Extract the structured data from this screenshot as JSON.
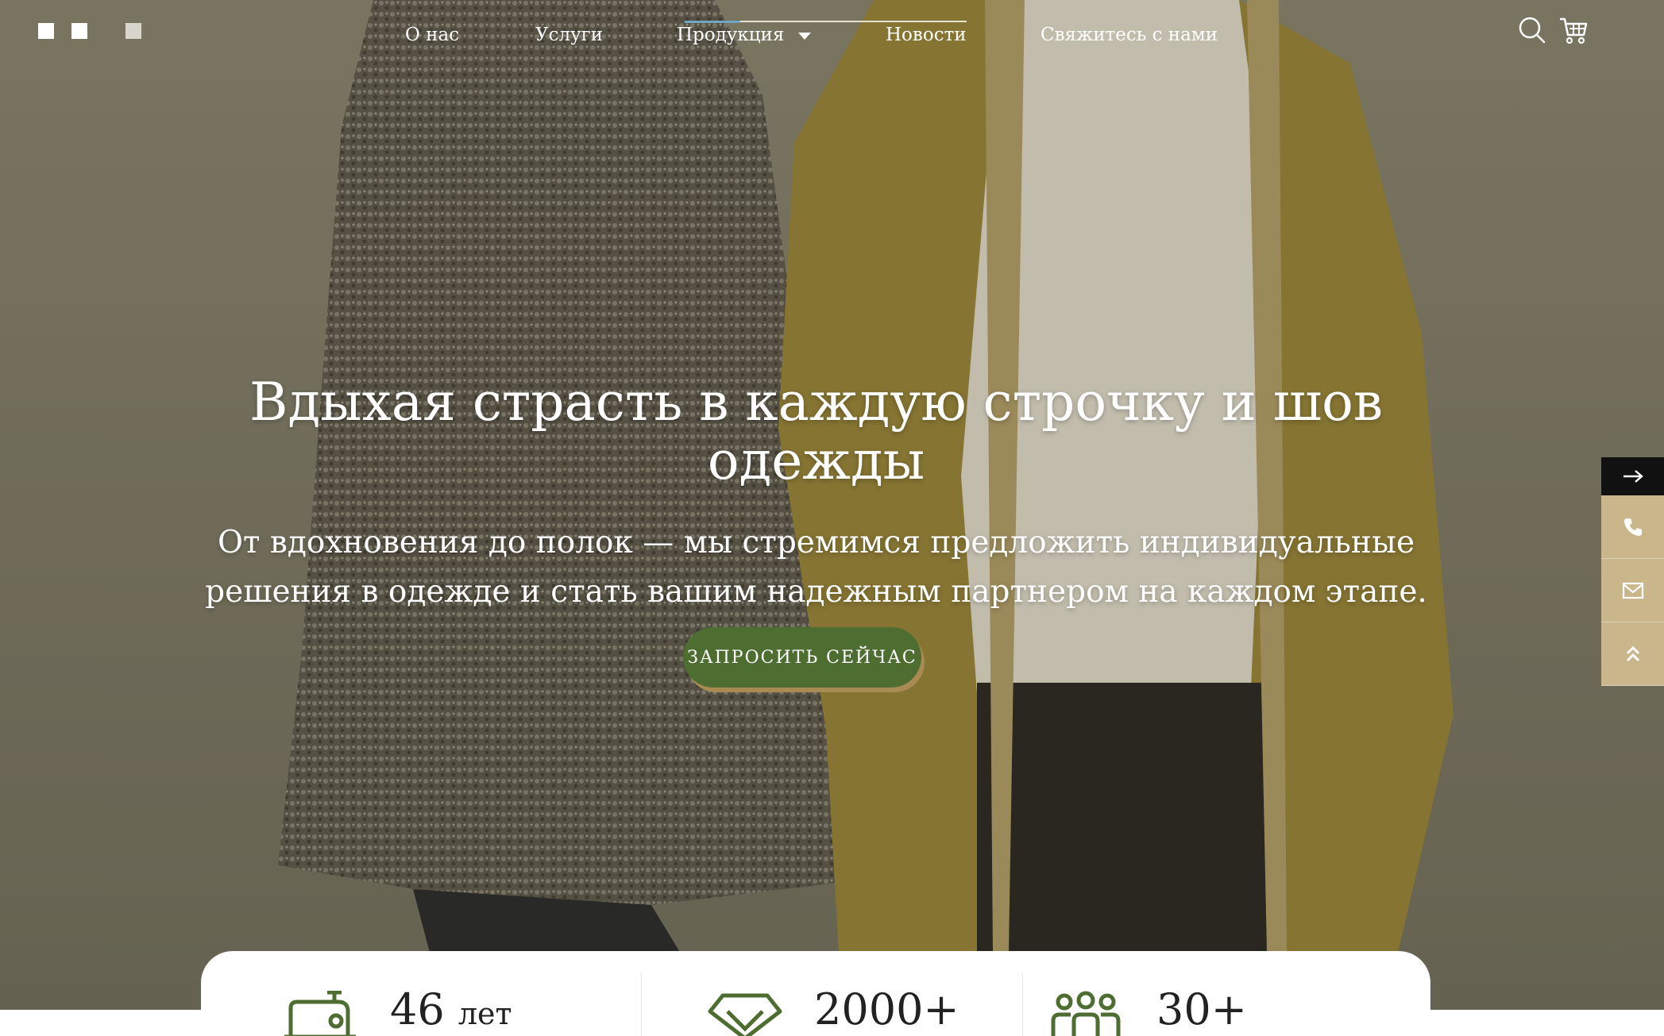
{
  "nav": {
    "items": [
      {
        "label": "О нас"
      },
      {
        "label": "Услуги"
      },
      {
        "label": "Продукция"
      },
      {
        "label": "Новости"
      },
      {
        "label": "Свяжитесь с нами"
      }
    ]
  },
  "header_icons": [
    "search-icon",
    "cart-icon"
  ],
  "hero": {
    "title": "Вдыхая страсть в каждую строчку и шов одежды",
    "subtitle": "От вдохновения до полок — мы стремимся предложить индивидуальные решения в одежде и стать вашим надежным партнером на каждом этапе.",
    "cta_label": "ЗАПРОСИТЬ СЕЙЧАС"
  },
  "float_bar": [
    "arrow-right-icon",
    "phone-icon",
    "mail-icon",
    "double-chevron-up-icon"
  ],
  "stats": [
    {
      "value": "46",
      "unit": "лет",
      "icon": "sewing-machine-icon"
    },
    {
      "value": "2000+",
      "unit": "",
      "icon": "diamond-icon"
    },
    {
      "value": "30+",
      "unit": "",
      "icon": "team-icon"
    }
  ],
  "colors": {
    "accent_green": "#4e6e31",
    "float_tan": "#c9b68a",
    "hero_bg": "#8b8670"
  }
}
